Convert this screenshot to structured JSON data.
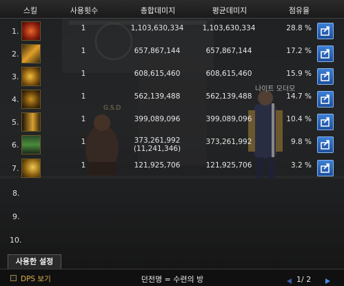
{
  "header": {
    "skill": "스킬",
    "uses": "사용횟수",
    "total": "총합데미지",
    "avg": "평균데미지",
    "share": "점유율"
  },
  "rows": [
    {
      "num": "1.",
      "icon": "flame-burst-icon",
      "uses": "1",
      "total": "1,103,630,334",
      "avg": "1,103,630,334",
      "share": "28.8 %",
      "color": "#c03a1a"
    },
    {
      "num": "2.",
      "icon": "slash-strike-icon",
      "uses": "1",
      "total": "657,867,144",
      "avg": "657,867,144",
      "share": "17.2 %",
      "color": "#d89020"
    },
    {
      "num": "3.",
      "icon": "spiral-slash-icon",
      "uses": "1",
      "total": "608,615,460",
      "avg": "608,615,460",
      "share": "15.9 %",
      "color": "#d8a020"
    },
    {
      "num": "4.",
      "icon": "whirlwind-icon",
      "uses": "1",
      "total": "562,139,488",
      "avg": "562,139,488",
      "share": "14.7 %",
      "color": "#b88018"
    },
    {
      "num": "5.",
      "icon": "dash-wave-icon",
      "uses": "1",
      "total": "399,089,096",
      "avg": "399,089,096",
      "share": "10.4 %",
      "color": "#c09028"
    },
    {
      "num": "6.",
      "icon": "rune-glyph-icon",
      "uses": "1",
      "total": "373,261,992",
      "total_sub": "(11,241,346)",
      "avg": "373,261,992",
      "share": "9.8 %",
      "color": "#3a7a3a"
    },
    {
      "num": "7.",
      "icon": "beast-strike-icon",
      "uses": "1",
      "total": "121,925,706",
      "avg": "121,925,706",
      "share": "3.2 %",
      "color": "#d0a030"
    }
  ],
  "empty_rows": [
    "8.",
    "9.",
    "10."
  ],
  "scene": {
    "npc_name": "나이트 모더모",
    "monster_label": "G.S.D"
  },
  "tab": {
    "label": "사용한 설정"
  },
  "bottom": {
    "dps_label": "DPS 보기",
    "dungeon": "던전명 = 수련의 방",
    "page": "1/ 2"
  },
  "colors": {
    "accent_blue": "#2a64b8",
    "gold": "#e0b050"
  }
}
